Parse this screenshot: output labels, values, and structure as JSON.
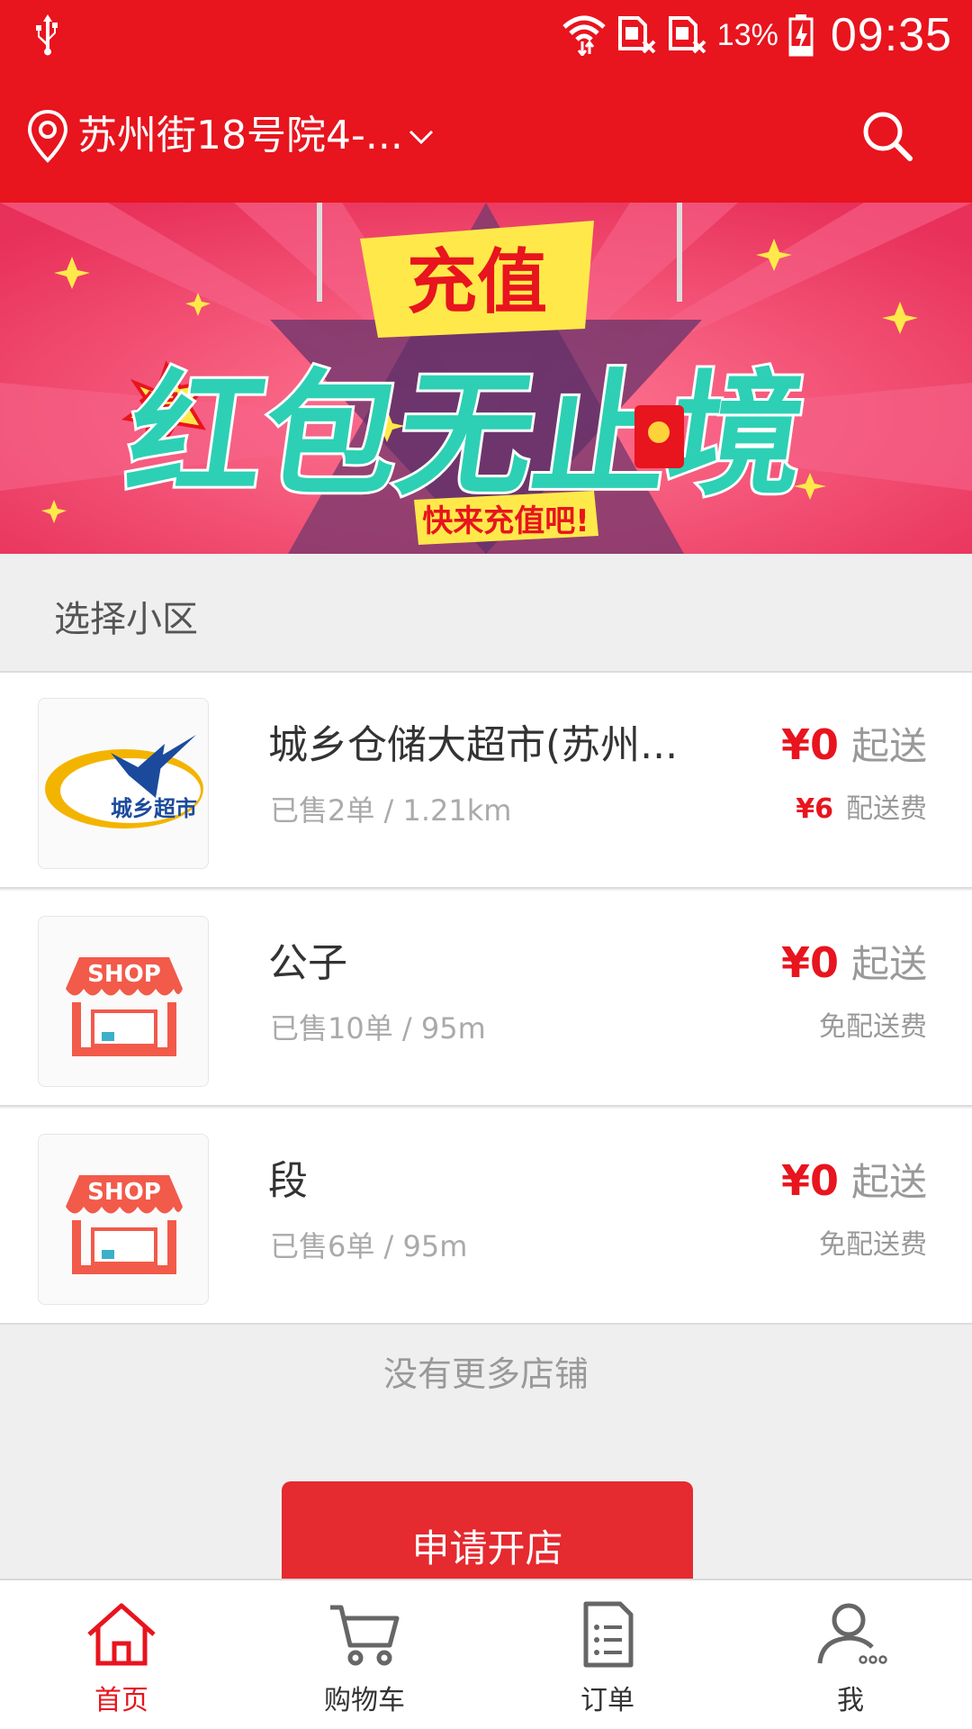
{
  "status_bar": {
    "battery": "13%",
    "time": "09:35"
  },
  "header": {
    "address": "苏州街18号院4-...",
    "icons": [
      "location-pin-icon",
      "chevron-down-icon",
      "search-icon"
    ]
  },
  "banner": {
    "title_small": "充值",
    "title_big": "红包无止境",
    "badge": "得",
    "subtitle": "快来充值吧!"
  },
  "section": {
    "title": "选择小区"
  },
  "stores": [
    {
      "name": "城乡仓储大超市(苏州...",
      "logo_text": "城乡超市",
      "meta": "已售2单 / 1.21km",
      "min_price": "¥0",
      "min_label": "起送",
      "fee_price": "¥6",
      "fee_label": "配送费"
    },
    {
      "name": "公子",
      "logo_text": "SHOP",
      "meta": "已售10单 / 95m",
      "min_price": "¥0",
      "min_label": "起送",
      "fee_price": "",
      "fee_label": "免配送费"
    },
    {
      "name": "段",
      "logo_text": "SHOP",
      "meta": "已售6单 / 95m",
      "min_price": "¥0",
      "min_label": "起送",
      "fee_price": "",
      "fee_label": "免配送费"
    }
  ],
  "footer_note": "没有更多店铺",
  "open_shop_button": "申请开店",
  "tabs": [
    {
      "label": "首页",
      "icon": "home-icon",
      "active": true
    },
    {
      "label": "购物车",
      "icon": "cart-icon",
      "active": false
    },
    {
      "label": "订单",
      "icon": "order-list-icon",
      "active": false
    },
    {
      "label": "我",
      "icon": "user-icon",
      "active": false
    }
  ],
  "colors": {
    "brand_red": "#e8141e",
    "button_red": "#e52a30",
    "muted_text": "#999999"
  }
}
